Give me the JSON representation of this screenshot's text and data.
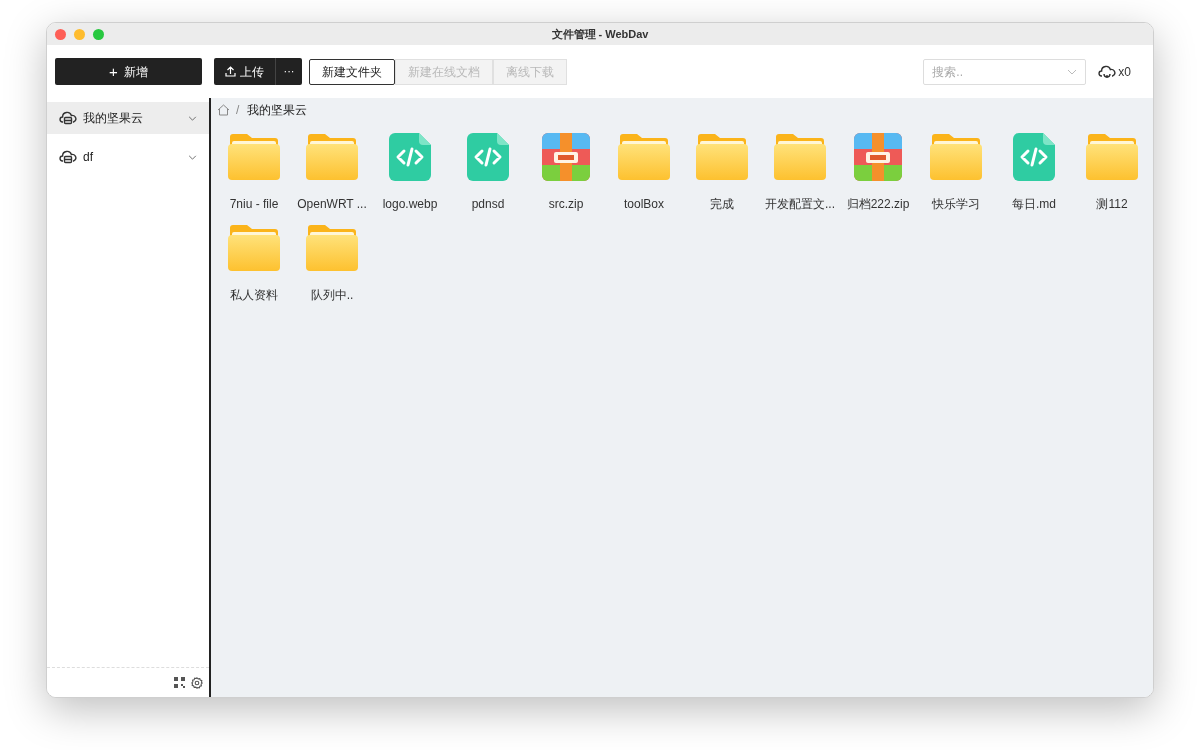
{
  "window": {
    "title": "文件管理 - WebDav"
  },
  "toolbar": {
    "new_button": {
      "icon": "+",
      "label": "新增"
    },
    "upload_button": "上传",
    "more_button": "···",
    "actions": [
      {
        "label": "新建文件夹",
        "disabled": false
      },
      {
        "label": "新建在线文档",
        "disabled": true
      },
      {
        "label": "离线下载",
        "disabled": true
      }
    ],
    "search": {
      "placeholder": "搜索.."
    },
    "transfer_count": "x0"
  },
  "sidebar": {
    "items": [
      {
        "label": "我的坚果云",
        "selected": true
      },
      {
        "label": "df",
        "selected": false
      }
    ]
  },
  "breadcrumb": {
    "separator": "/",
    "current": "我的坚果云"
  },
  "files": [
    {
      "name": "7niu - file",
      "kind": "folder"
    },
    {
      "name": "OpenWRT ...",
      "kind": "folder"
    },
    {
      "name": "logo.webp",
      "kind": "code"
    },
    {
      "name": "pdnsd",
      "kind": "code"
    },
    {
      "name": "src.zip",
      "kind": "zip"
    },
    {
      "name": "toolBox",
      "kind": "folder"
    },
    {
      "name": "完成",
      "kind": "folder"
    },
    {
      "name": "开发配置文...",
      "kind": "folder"
    },
    {
      "name": "归档222.zip",
      "kind": "zip"
    },
    {
      "name": "快乐学习",
      "kind": "folder"
    },
    {
      "name": "每日.md",
      "kind": "code"
    },
    {
      "name": "测112",
      "kind": "folder"
    },
    {
      "name": "私人资料",
      "kind": "folder"
    },
    {
      "name": "队列中..",
      "kind": "folder"
    }
  ]
}
